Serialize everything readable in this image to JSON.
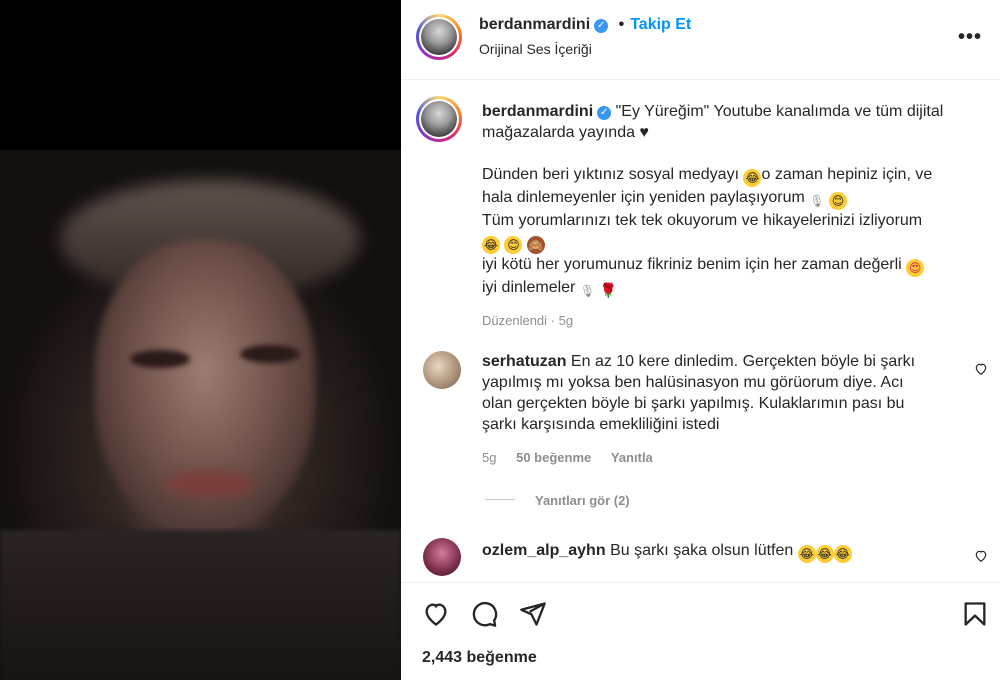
{
  "post": {
    "username": "berdanmardini",
    "follow_label": "Takip Et",
    "audio_label": "Orijinal Ses İçeriği",
    "caption_lines": [
      "\"Ey Yüreğim\" Youtube kanalımda ve tüm dijital",
      "mağazalarda yayında ♥",
      "Dünden beri yıktınız sosyal medyayı",
      "o zaman hepiniz için, ve",
      "hala dinlemeyenler için yeniden paylaşıyorum",
      "Tüm yorumlarınızı tek tek okuyorum ve hikayelerinizi izliyorum",
      "iyi kötü her yorumunuz fikriniz benim için her zaman değerli",
      "iyi dinlemeler"
    ],
    "edited_label": "Düzenlendi",
    "edited_age": "5g"
  },
  "comments": [
    {
      "username": "serhatuzan",
      "text_lines": [
        "En az 10 kere dinledim. Gerçekten böyle bi şarkı",
        "yapılmış mı yoksa ben halüsinasyon mu görüorum diye. Acı",
        "olan gerçekten böyle bi şarkı yapılmış. Kulaklarımın pası bu",
        "şarkı karşısında emekliliğini istedi"
      ],
      "age": "5g",
      "likes": "50 beğenme",
      "reply_label": "Yanıtla",
      "view_replies": "Yanıtları gör (2)"
    },
    {
      "username": "ozlem_alp_ayhn",
      "text": "Bu şarkı şaka olsun lütfen"
    }
  ],
  "footer": {
    "likes": "2,443 beğenme"
  },
  "icons": [
    "verified-icon",
    "more-icon",
    "heart-icon",
    "comment-icon",
    "share-icon",
    "bookmark-icon"
  ],
  "colors": {
    "accent": "#0095f6",
    "text": "#262626",
    "muted": "#8e8e8e"
  }
}
